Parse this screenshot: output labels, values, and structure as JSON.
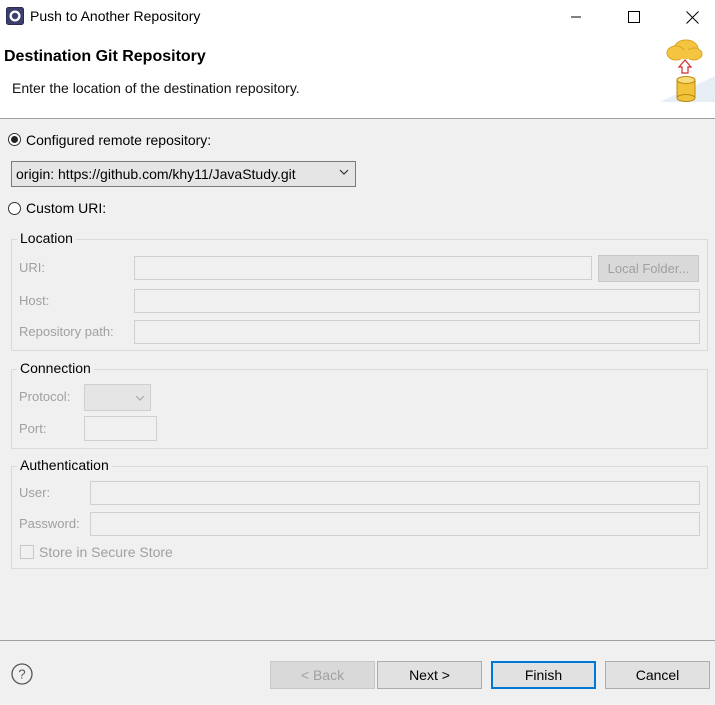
{
  "window": {
    "title": "Push to Another Repository",
    "controls": [
      "minimize-icon",
      "maximize-icon",
      "close-icon"
    ]
  },
  "header": {
    "title": "Destination Git Repository",
    "description": "Enter the location of the destination repository.",
    "image_icon": "cloud-upload-database-icon"
  },
  "options": {
    "configured_label": "Configured remote repository:",
    "configured_selected": true,
    "remote_value": "origin: https://github.com/khy11/JavaStudy.git",
    "custom_label": "Custom URI:",
    "custom_selected": false
  },
  "location": {
    "title": "Location",
    "uri_label": "URI:",
    "uri_value": "",
    "local_folder_button": "Local Folder...",
    "host_label": "Host:",
    "host_value": "",
    "path_label": "Repository path:",
    "path_value": ""
  },
  "connection": {
    "title": "Connection",
    "protocol_label": "Protocol:",
    "protocol_value": "",
    "port_label": "Port:",
    "port_value": ""
  },
  "authentication": {
    "title": "Authentication",
    "user_label": "User:",
    "user_value": "",
    "password_label": "Password:",
    "password_value": "",
    "store_label": "Store in Secure Store",
    "store_checked": false
  },
  "footer": {
    "help_icon": "help-icon",
    "back": "< Back",
    "next": "Next >",
    "finish": "Finish",
    "cancel": "Cancel"
  },
  "colors": {
    "default_button_border": "#0078d7",
    "disabled_text": "#a0a0a0",
    "background": "#f0f0f0"
  }
}
